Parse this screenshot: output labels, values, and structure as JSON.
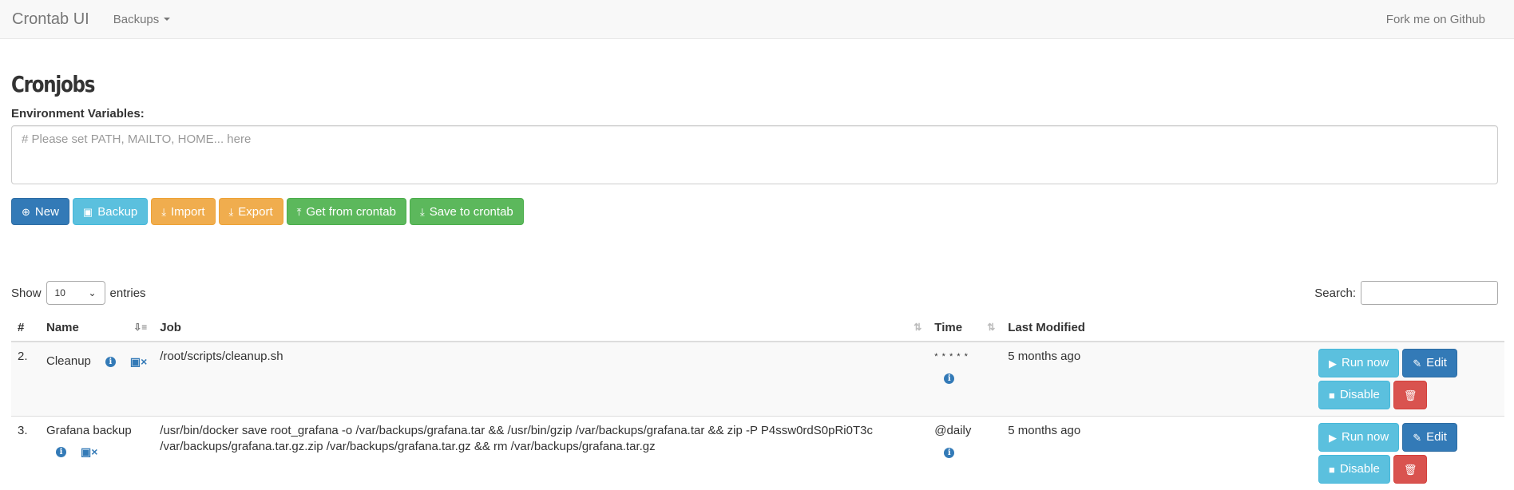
{
  "navbar": {
    "brand": "Crontab UI",
    "backups_label": "Backups",
    "github_label": "Fork me on Github"
  },
  "page": {
    "title": "Cronjobs",
    "env_label": "Environment Variables:",
    "env_placeholder": "# Please set PATH, MAILTO, HOME... here",
    "env_value": ""
  },
  "toolbar": {
    "new": "New",
    "backup": "Backup",
    "import": "Import",
    "export": "Export",
    "get": "Get from crontab",
    "save": "Save to crontab"
  },
  "table_controls": {
    "show": "Show",
    "entries": "entries",
    "page_length": "10",
    "search_label": "Search:"
  },
  "columns": {
    "num": "#",
    "name": "Name",
    "job": "Job",
    "time": "Time",
    "modified": "Last Modified"
  },
  "rows": [
    {
      "num": "2.",
      "name": "Cleanup",
      "job": "/root/scripts/cleanup.sh",
      "time": "* * * * *",
      "modified": "5 months ago",
      "run": "Run now",
      "edit": "Edit",
      "disable": "Disable"
    },
    {
      "num": "3.",
      "name": "Grafana backup",
      "job": "/usr/bin/docker save root_grafana -o /var/backups/grafana.tar && /usr/bin/gzip /var/backups/grafana.tar && zip -P P4ssw0rdS0pRi0T3c /var/backups/grafana.tar.gz.zip /var/backups/grafana.tar.gz && rm /var/backups/grafana.tar.gz",
      "time": "@daily",
      "modified": "5 months ago",
      "run": "Run now",
      "edit": "Edit",
      "disable": "Disable"
    }
  ],
  "colors": {
    "primary": "#337ab7",
    "info": "#5bc0de",
    "warning": "#f0ad4e",
    "success": "#5cb85c",
    "danger": "#d9534f"
  }
}
